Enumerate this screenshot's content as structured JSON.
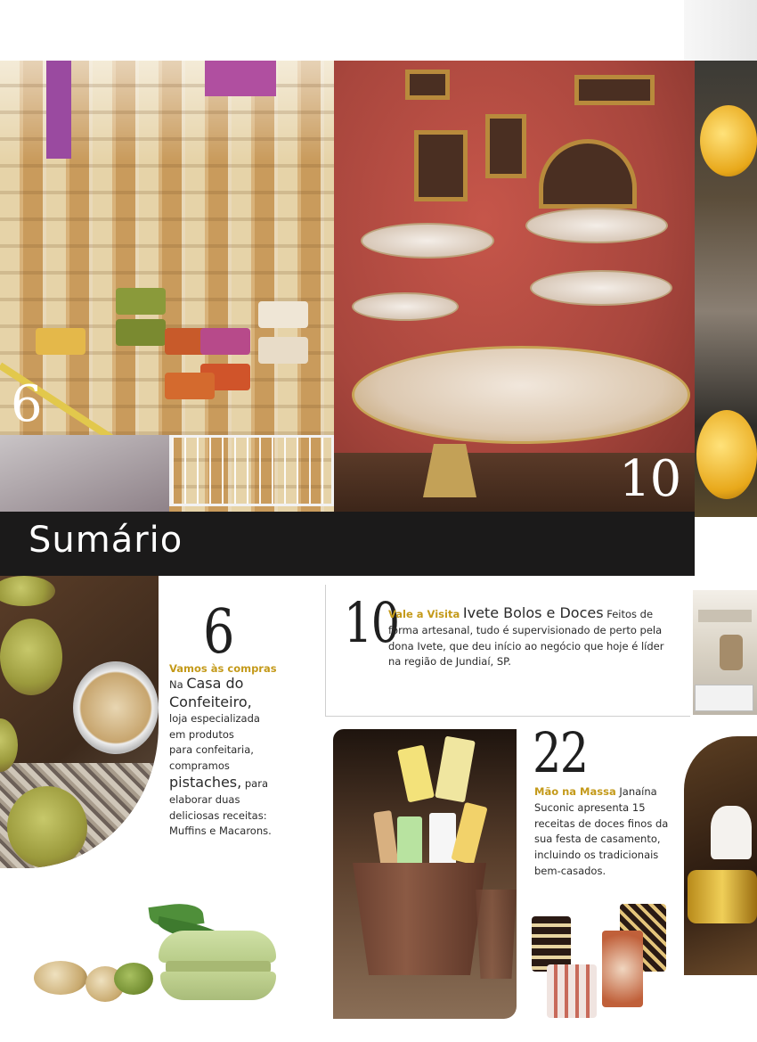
{
  "page_title": "Sumário",
  "photo_numbers": {
    "shop": "6",
    "cafe": "10"
  },
  "entries": [
    {
      "number": "6",
      "kicker": "Vamos às compras",
      "lines": [
        {
          "lead": "Na ",
          "big": "Casa do"
        },
        {
          "big": "Confeiteiro,"
        },
        {
          "text": "loja especializada"
        },
        {
          "text": "em produtos"
        },
        {
          "text": "para confeitaria,"
        },
        {
          "text": "compramos"
        },
        {
          "big": "pistaches,",
          "tail": " para"
        },
        {
          "text": "elaborar duas"
        },
        {
          "text": "deliciosas receitas:"
        },
        {
          "text": "Muffins e Macarons."
        }
      ]
    },
    {
      "number": "10",
      "kicker": "Vale a Visita",
      "headline": "Ivete Bolos e Doces",
      "first_line_tail": "Feitos de",
      "lines": [
        "forma artesanal, tudo é supervisionado de perto pela",
        "dona Ivete, que deu início ao negócio que hoje é líder",
        "na região de Jundiaí, SP."
      ]
    },
    {
      "number": "22",
      "kicker": "Mão na Massa",
      "first_line_tail": "Janaína",
      "lines": [
        "Suconic apresenta 15",
        "receitas de doces finos da",
        "sua festa de casamento,",
        "incluindo os tradicionais",
        "bem-casados."
      ]
    }
  ],
  "colors": {
    "accent": "#c49a1a",
    "bar": "#1b1a1a",
    "text": "#2a2a2a"
  },
  "icons": {
    "decor": "photo-placeholder"
  }
}
